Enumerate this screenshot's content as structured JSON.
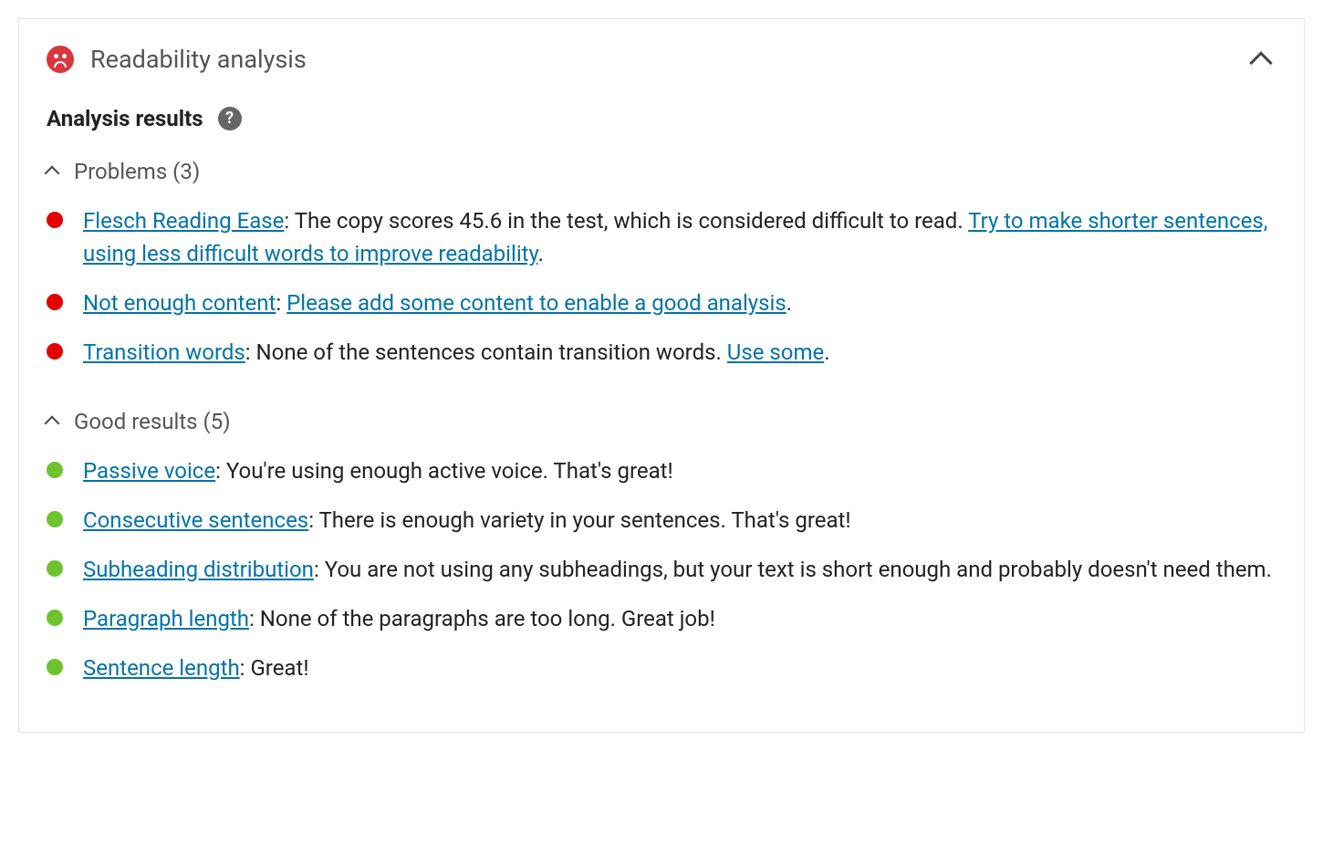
{
  "panel": {
    "title": "Readability analysis",
    "status_icon": "sad-face"
  },
  "results_header": "Analysis results",
  "help_glyph": "?",
  "sections": {
    "problems": {
      "label": "Problems (3)",
      "items": [
        {
          "link_label": "Flesch Reading Ease",
          "text_before": ": The copy scores 45.6 in the test, which is considered difficult to read. ",
          "action_link": "Try to make shorter sentences, using less difficult words to improve readability",
          "tail": "."
        },
        {
          "link_label": "Not enough content",
          "text_before": ": ",
          "action_link": "Please add some content to enable a good analysis",
          "tail": "."
        },
        {
          "link_label": "Transition words",
          "text_before": ": None of the sentences contain transition words. ",
          "action_link": "Use some",
          "tail": "."
        }
      ]
    },
    "good": {
      "label": "Good results (5)",
      "items": [
        {
          "link_label": "Passive voice",
          "text": ": You're using enough active voice. That's great!"
        },
        {
          "link_label": "Consecutive sentences",
          "text": ": There is enough variety in your sentences. That's great!"
        },
        {
          "link_label": "Subheading distribution",
          "text": ": You are not using any subheadings, but your text is short enough and probably doesn't need them."
        },
        {
          "link_label": "Paragraph length",
          "text": ": None of the paragraphs are too long. Great job!"
        },
        {
          "link_label": "Sentence length",
          "text": ": Great!"
        }
      ]
    }
  }
}
